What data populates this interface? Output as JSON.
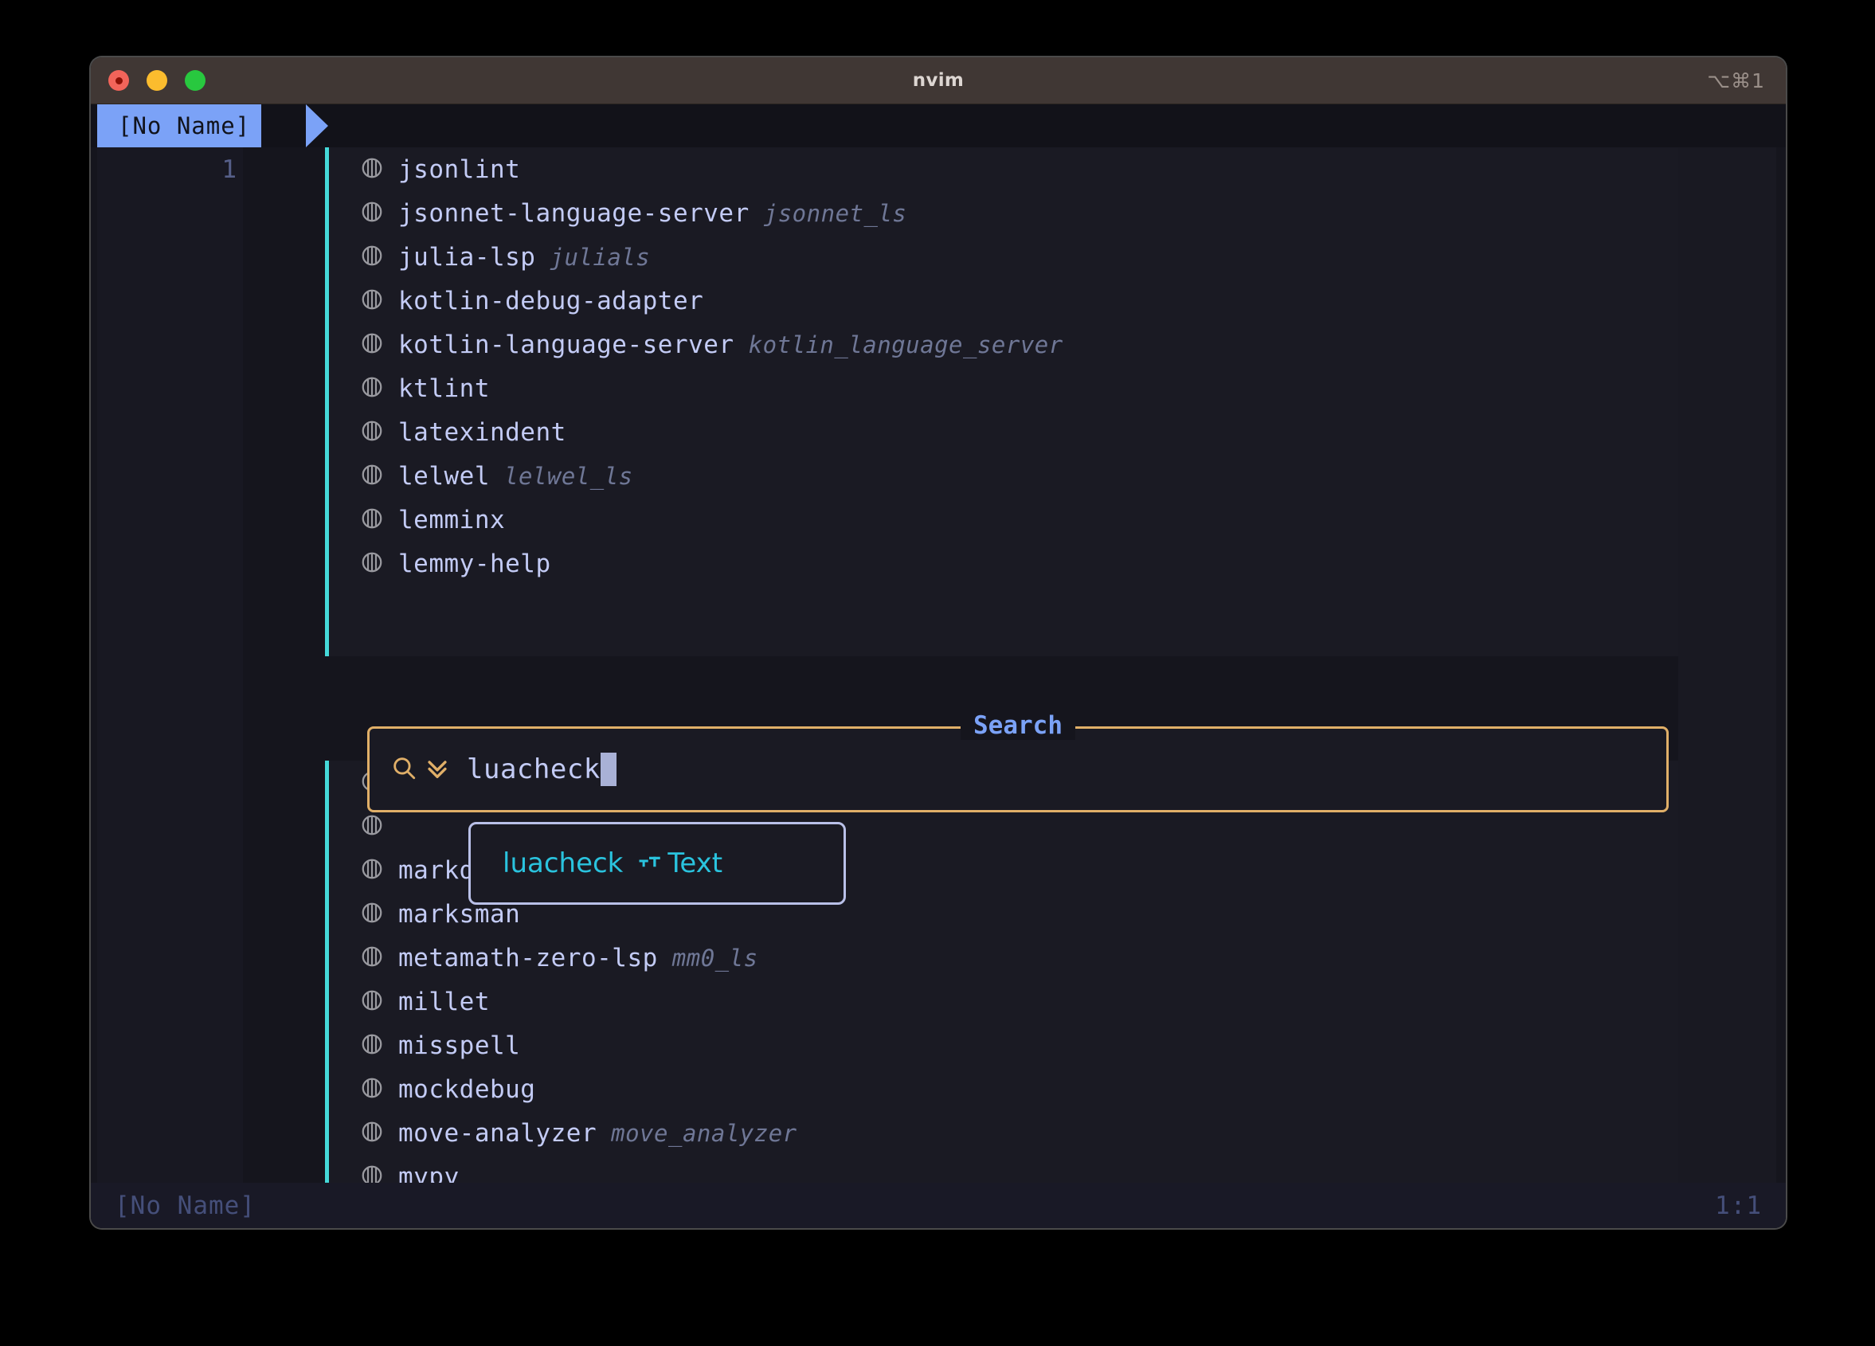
{
  "window": {
    "title": "nvim",
    "shortcut": "⌥⌘1",
    "traffic_lights": [
      "close-red",
      "minimize-yellow",
      "maximize-green"
    ]
  },
  "tabline": {
    "active_tab": "[No Name]"
  },
  "gutter": {
    "line_number": "1"
  },
  "list_top": {
    "items": [
      {
        "name": "jsonlint",
        "alias": ""
      },
      {
        "name": "jsonnet-language-server",
        "alias": "jsonnet_ls"
      },
      {
        "name": "julia-lsp",
        "alias": "julials"
      },
      {
        "name": "kotlin-debug-adapter",
        "alias": ""
      },
      {
        "name": "kotlin-language-server",
        "alias": "kotlin_language_server"
      },
      {
        "name": "ktlint",
        "alias": ""
      },
      {
        "name": "latexindent",
        "alias": ""
      },
      {
        "name": "lelwel",
        "alias": "lelwel_ls"
      },
      {
        "name": "lemminx",
        "alias": ""
      },
      {
        "name": "lemmy-help",
        "alias": ""
      }
    ]
  },
  "list_bottom": {
    "items": [
      {
        "name": "",
        "alias": ""
      },
      {
        "name": "",
        "alias": ""
      },
      {
        "name": "markdownlint",
        "alias": ""
      },
      {
        "name": "marksman",
        "alias": ""
      },
      {
        "name": "metamath-zero-lsp",
        "alias": "mm0_ls"
      },
      {
        "name": "millet",
        "alias": ""
      },
      {
        "name": "misspell",
        "alias": ""
      },
      {
        "name": "mockdebug",
        "alias": ""
      },
      {
        "name": "move-analyzer",
        "alias": "move_analyzer"
      },
      {
        "name": "mypy",
        "alias": ""
      }
    ]
  },
  "search": {
    "title": "Search",
    "value": "luacheck",
    "search_icon": "magnifier-icon",
    "chevrons_icon": "double-chevron-down-icon"
  },
  "completion": {
    "items": [
      {
        "label": "luacheck",
        "kind_icon": "text-kind-icon",
        "kind": "Text"
      }
    ]
  },
  "statusline": {
    "left": "[No Name]",
    "right": "1:1"
  },
  "colors": {
    "accent_border": "#e0af68",
    "tab_active_bg": "#7ba2f7",
    "panel_border_left": "#45d9d9",
    "completion_text": "#2ac3de",
    "list_text": "#c3cbf5",
    "list_alias": "#6f7796",
    "titlebar_bg": "#403734"
  }
}
